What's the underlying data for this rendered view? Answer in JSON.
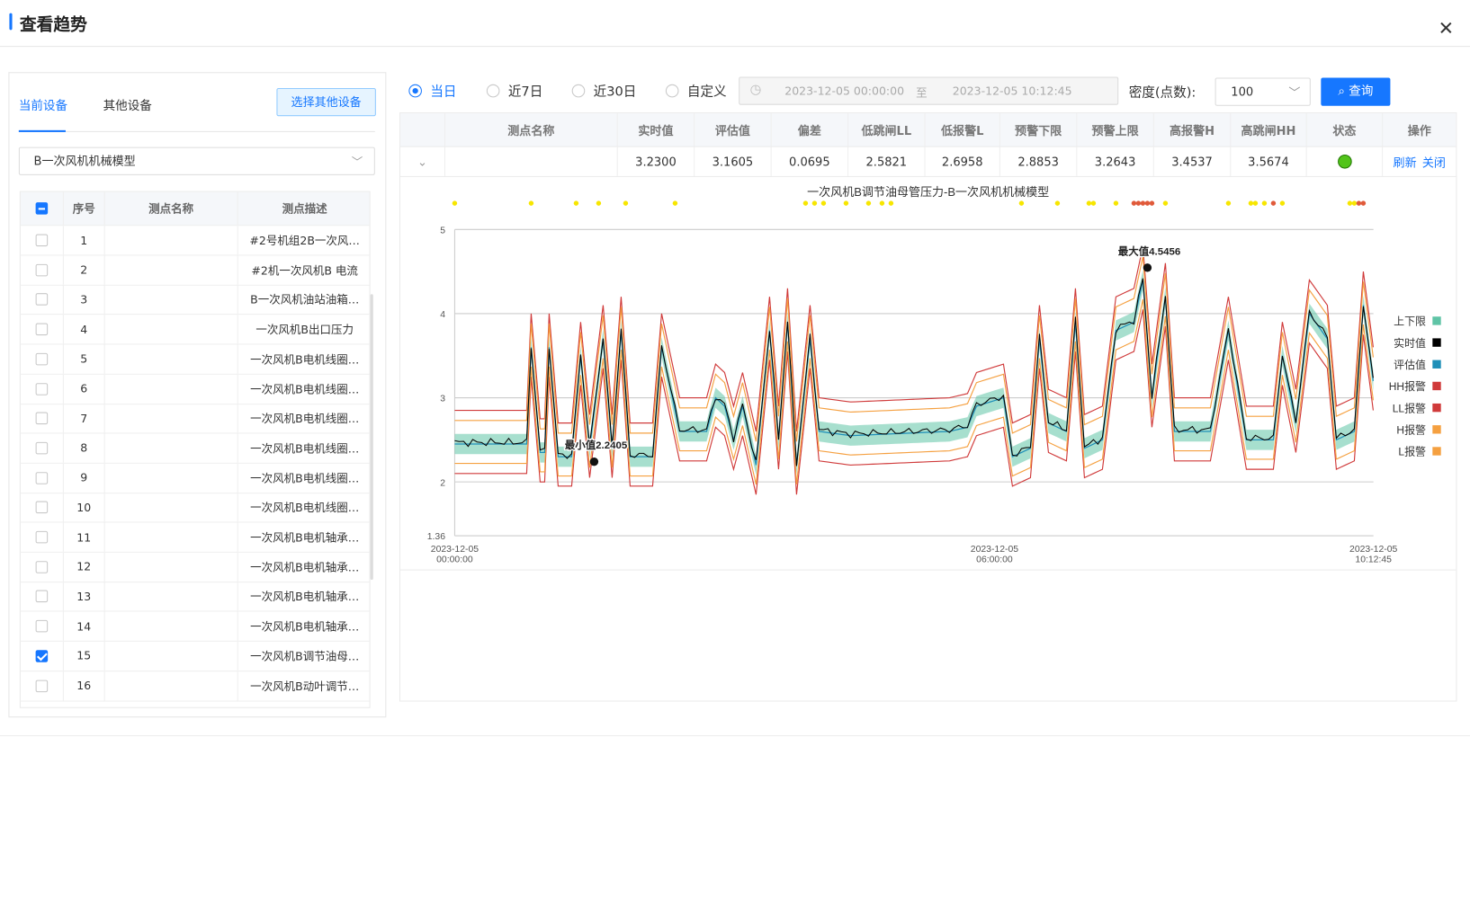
{
  "header": {
    "title": "查看趋势"
  },
  "left": {
    "tabs": [
      {
        "label": "当前设备",
        "active": true
      },
      {
        "label": "其他设备",
        "active": false
      }
    ],
    "other_button": "选择其他设备",
    "device_select": "B一次风机机械模型",
    "columns": [
      "序号",
      "测点名称",
      "测点描述"
    ],
    "rows": [
      {
        "no": "1",
        "name": "",
        "desc": "#2号机组2B一次风…",
        "checked": false
      },
      {
        "no": "2",
        "name": "",
        "desc": "#2机一次风机B 电流",
        "checked": false
      },
      {
        "no": "3",
        "name": "",
        "desc": "B一次风机油站油箱…",
        "checked": false
      },
      {
        "no": "4",
        "name": "",
        "desc": "一次风机B出口压力",
        "checked": false
      },
      {
        "no": "5",
        "name": "",
        "desc": "一次风机B电机线圈…",
        "checked": false
      },
      {
        "no": "6",
        "name": "",
        "desc": "一次风机B电机线圈…",
        "checked": false
      },
      {
        "no": "7",
        "name": "",
        "desc": "一次风机B电机线圈…",
        "checked": false
      },
      {
        "no": "8",
        "name": "",
        "desc": "一次风机B电机线圈…",
        "checked": false
      },
      {
        "no": "9",
        "name": "",
        "desc": "一次风机B电机线圈…",
        "checked": false
      },
      {
        "no": "10",
        "name": "",
        "desc": "一次风机B电机线圈…",
        "checked": false
      },
      {
        "no": "11",
        "name": "",
        "desc": "一次风机B电机轴承…",
        "checked": false
      },
      {
        "no": "12",
        "name": "",
        "desc": "一次风机B电机轴承…",
        "checked": false
      },
      {
        "no": "13",
        "name": "",
        "desc": "一次风机B电机轴承…",
        "checked": false
      },
      {
        "no": "14",
        "name": "",
        "desc": "一次风机B电机轴承…",
        "checked": false
      },
      {
        "no": "15",
        "name": "",
        "desc": "一次风机B调节油母…",
        "checked": true
      },
      {
        "no": "16",
        "name": "",
        "desc": "一次风机B动叶调节…",
        "checked": false
      }
    ]
  },
  "toolbar": {
    "radios": [
      {
        "label": "当日",
        "on": true
      },
      {
        "label": "近7日",
        "on": false
      },
      {
        "label": "近30日",
        "on": false
      },
      {
        "label": "自定义",
        "on": false
      }
    ],
    "range_start": "2023-12-05 00:00:00",
    "range_sep": "至",
    "range_end": "2023-12-05 10:12:45",
    "density_label": "密度(点数):",
    "density_value": "100",
    "query_label": "查询"
  },
  "table": {
    "columns": [
      "测点名称",
      "实时值",
      "评估值",
      "偏差",
      "低跳闸LL",
      "低报警L",
      "预警下限",
      "预警上限",
      "高报警H",
      "高跳闸HH",
      "状态",
      "操作"
    ],
    "row": {
      "name": "",
      "values": [
        "3.2300",
        "3.1605",
        "0.0695",
        "2.5821",
        "2.6958",
        "2.8853",
        "3.2643",
        "3.4537",
        "3.5674"
      ],
      "status_color": "#52c41a",
      "ops": [
        "刷新",
        "关闭"
      ]
    }
  },
  "chart_data": {
    "type": "line",
    "title": "一次风机B调节油母管压力-B一次风机机械模型",
    "ylim": [
      1.36,
      5
    ],
    "yticks": [
      "5",
      "4",
      "3",
      "2",
      "1.36"
    ],
    "xticks": [
      {
        "date": "2023-12-05",
        "time": "00:00:00"
      },
      {
        "date": "2023-12-05",
        "time": "06:00:00"
      },
      {
        "date": "2023-12-05",
        "time": "10:12:45"
      }
    ],
    "legend": [
      {
        "name": "上下限",
        "color": "#5fc4a6"
      },
      {
        "name": "实时值",
        "color": "#000000"
      },
      {
        "name": "评估值",
        "color": "#1f8fb8"
      },
      {
        "name": "HH报警",
        "color": "#d03a3a"
      },
      {
        "name": "LL报警",
        "color": "#d03a3a"
      },
      {
        "name": "H报警",
        "color": "#f5a040"
      },
      {
        "name": "L报警",
        "color": "#f5a040"
      }
    ],
    "annotations": [
      {
        "label": "最大值4.5456",
        "time_hours": 7.7,
        "value": 4.5456
      },
      {
        "label": "最小值2.2405",
        "time_hours": 1.55,
        "value": 2.2405
      }
    ],
    "estimate_profile": [
      {
        "t": 0.0,
        "v": 2.45
      },
      {
        "t": 0.8,
        "v": 2.45
      },
      {
        "t": 0.85,
        "v": 3.6
      },
      {
        "t": 0.95,
        "v": 2.35
      },
      {
        "t": 1.0,
        "v": 2.35
      },
      {
        "t": 1.05,
        "v": 3.6
      },
      {
        "t": 1.15,
        "v": 2.3
      },
      {
        "t": 1.3,
        "v": 2.3
      },
      {
        "t": 1.4,
        "v": 3.5
      },
      {
        "t": 1.5,
        "v": 2.4
      },
      {
        "t": 1.65,
        "v": 3.7
      },
      {
        "t": 1.75,
        "v": 2.4
      },
      {
        "t": 1.85,
        "v": 3.8
      },
      {
        "t": 1.95,
        "v": 2.3
      },
      {
        "t": 2.2,
        "v": 2.3
      },
      {
        "t": 2.3,
        "v": 3.6
      },
      {
        "t": 2.5,
        "v": 2.6
      },
      {
        "t": 2.8,
        "v": 2.6
      },
      {
        "t": 2.9,
        "v": 3.0
      },
      {
        "t": 3.0,
        "v": 2.9
      },
      {
        "t": 3.1,
        "v": 2.5
      },
      {
        "t": 3.2,
        "v": 2.9
      },
      {
        "t": 3.35,
        "v": 2.2
      },
      {
        "t": 3.5,
        "v": 3.8
      },
      {
        "t": 3.6,
        "v": 2.5
      },
      {
        "t": 3.7,
        "v": 3.9
      },
      {
        "t": 3.8,
        "v": 2.2
      },
      {
        "t": 3.95,
        "v": 3.7
      },
      {
        "t": 4.05,
        "v": 2.6
      },
      {
        "t": 4.4,
        "v": 2.55
      },
      {
        "t": 5.5,
        "v": 2.6
      },
      {
        "t": 5.7,
        "v": 2.65
      },
      {
        "t": 5.8,
        "v": 2.9
      },
      {
        "t": 6.1,
        "v": 3.0
      },
      {
        "t": 6.2,
        "v": 2.3
      },
      {
        "t": 6.4,
        "v": 2.4
      },
      {
        "t": 6.5,
        "v": 3.7
      },
      {
        "t": 6.6,
        "v": 2.7
      },
      {
        "t": 6.8,
        "v": 2.6
      },
      {
        "t": 6.9,
        "v": 3.9
      },
      {
        "t": 7.0,
        "v": 2.4
      },
      {
        "t": 7.2,
        "v": 2.5
      },
      {
        "t": 7.35,
        "v": 3.8
      },
      {
        "t": 7.55,
        "v": 3.9
      },
      {
        "t": 7.65,
        "v": 4.4
      },
      {
        "t": 7.75,
        "v": 3.0
      },
      {
        "t": 7.9,
        "v": 4.2
      },
      {
        "t": 8.0,
        "v": 2.6
      },
      {
        "t": 8.4,
        "v": 2.6
      },
      {
        "t": 8.6,
        "v": 3.8
      },
      {
        "t": 8.8,
        "v": 2.5
      },
      {
        "t": 9.1,
        "v": 2.5
      },
      {
        "t": 9.2,
        "v": 3.5
      },
      {
        "t": 9.35,
        "v": 2.7
      },
      {
        "t": 9.5,
        "v": 4.0
      },
      {
        "t": 9.7,
        "v": 3.7
      },
      {
        "t": 9.8,
        "v": 2.5
      },
      {
        "t": 10.0,
        "v": 2.6
      },
      {
        "t": 10.1,
        "v": 4.1
      },
      {
        "t": 10.21,
        "v": 3.2
      }
    ],
    "band_half_width": 0.12,
    "hh_offset": 0.4,
    "ll_offset": 0.35,
    "h_offset": 0.28,
    "l_offset": 0.23,
    "alarm_dots_hours": [
      0.0,
      0.85,
      1.35,
      1.6,
      1.9,
      2.45,
      3.9,
      4.0,
      4.1,
      4.35,
      4.6,
      4.75,
      4.85,
      6.3,
      6.7,
      7.05,
      7.1,
      7.35,
      7.55,
      7.6,
      7.65,
      7.7,
      7.75,
      7.9,
      8.6,
      8.85,
      8.9,
      9.0,
      9.1,
      9.2,
      9.95,
      10.0,
      10.05,
      10.1
    ]
  }
}
